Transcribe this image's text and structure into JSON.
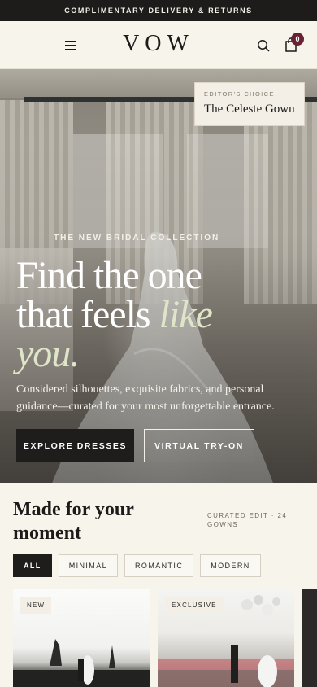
{
  "promo": {
    "text": "COMPLIMENTARY DELIVERY & RETURNS"
  },
  "header": {
    "logo": "VOW",
    "cart_count": "0"
  },
  "hero": {
    "editor_kicker": "EDITOR'S CHOICE",
    "editor_title": "The Celeste Gown",
    "eyebrow": "THE NEW BRIDAL COLLECTION",
    "headline_line1": "Find the one",
    "headline_line2": "that feels ",
    "headline_accent1": "like",
    "headline_accent2": "you.",
    "description": "Considered silhouettes, exquisite fabrics, and personal guidance—curated for your most unforgettable entrance.",
    "primary_cta": "EXPLORE DRESSES",
    "secondary_cta": "VIRTUAL TRY-ON"
  },
  "collection": {
    "title": "Made for your moment",
    "count": "CURATED EDIT · 24 GOWNS",
    "filters": [
      "ALL",
      "MINIMAL",
      "ROMANTIC",
      "MODERN"
    ],
    "active_filter": "ALL",
    "cards": [
      {
        "tag": "NEW"
      },
      {
        "tag": "EXCLUSIVE"
      }
    ]
  },
  "colors": {
    "background": "#f7f4ec",
    "dark": "#1e1d1b",
    "badge": "#6a2233",
    "accent_text": "#dfe5c8"
  },
  "icons": [
    "menu-icon",
    "search-icon",
    "bag-icon"
  ]
}
